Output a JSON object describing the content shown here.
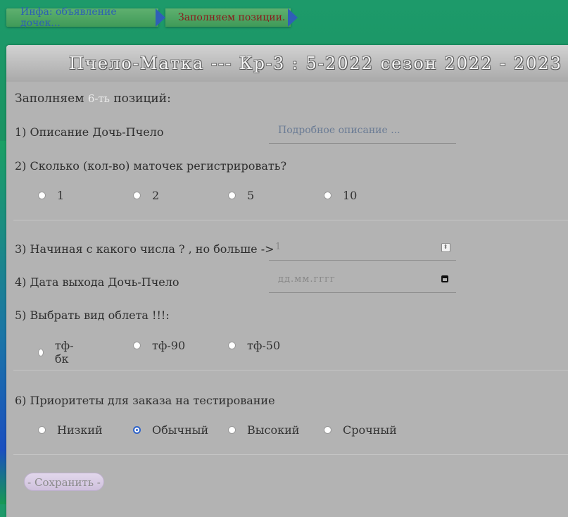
{
  "breadcrumbs": [
    {
      "label": "Инфа: объявление дочек..."
    },
    {
      "label": "Заполняем позиции."
    }
  ],
  "panel": {
    "title": "Пчело-Матка --- Кр-3 : 5-2022 сезон 2022 - 2023"
  },
  "form": {
    "intro_prefix": "Заполняем",
    "intro_highlight": "6-ть",
    "intro_suffix": "позиций:",
    "q1": {
      "label": "1) Описание Дочь-Пчело",
      "placeholder": "Подробное описание ..."
    },
    "q2": {
      "label": "2) Сколько (кол-во) маточек регистрировать?",
      "options": [
        "1",
        "2",
        "5",
        "10"
      ]
    },
    "q3": {
      "label": "3) Начиная с какого числа ? , но больше ->",
      "placeholder": "1"
    },
    "q4": {
      "label": "4) Дата выхода Дочь-Пчело",
      "placeholder": "дд.мм.гггг"
    },
    "q5": {
      "label": "5) Выбрать вид облета !!!:",
      "options": [
        "тф-бк",
        "тф-90",
        "тф-50"
      ]
    },
    "q6": {
      "label": "6) Приоритеты для заказа на тестирование",
      "options": [
        "Низкий",
        "Обычный",
        "Высокий",
        "Срочный"
      ],
      "selected": "Обычный"
    },
    "save_label": "- Сохранить -"
  },
  "colors": {
    "accent": "#2d62c8",
    "panel": "#b3b3b3",
    "background": "#1d9a6a"
  }
}
